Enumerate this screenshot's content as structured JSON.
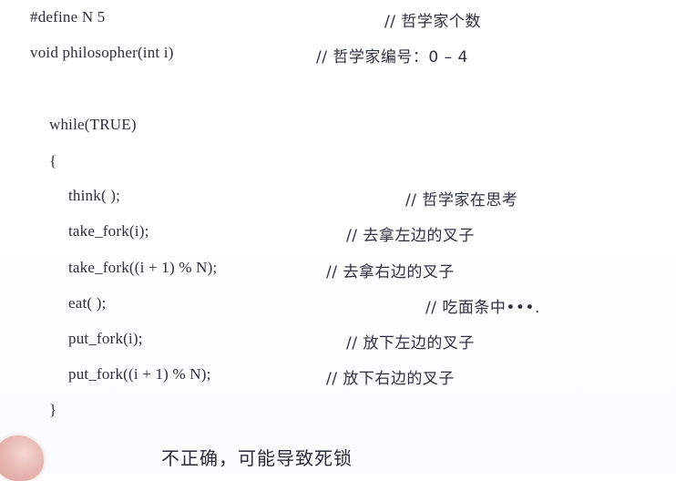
{
  "slide": {
    "lines": [
      {
        "code": "#define   N   5",
        "comment": "//  哲学家个数"
      },
      {
        "code": "void   philosopher(int   i)",
        "comment": "//  哲学家编号：0  –  4"
      },
      {
        "code": "while(TRUE)",
        "comment": ""
      },
      {
        "code": "{",
        "comment": ""
      },
      {
        "code": "think( );",
        "comment": "//  哲学家在思考"
      },
      {
        "code": "take_fork(i);",
        "comment": "//  去拿左边的叉子"
      },
      {
        "code": "take_fork((i + 1) % N);",
        "comment": "//  去拿右边的叉子"
      },
      {
        "code": "eat( );",
        "comment": "//  吃面条中•••."
      },
      {
        "code": "put_fork(i);",
        "comment": "//  放下左边的叉子"
      },
      {
        "code": "put_fork((i + 1) % N);",
        "comment": "//  放下右边的叉子"
      },
      {
        "code": "}",
        "comment": ""
      }
    ],
    "footer_note": "不正确，可能导致死锁"
  }
}
